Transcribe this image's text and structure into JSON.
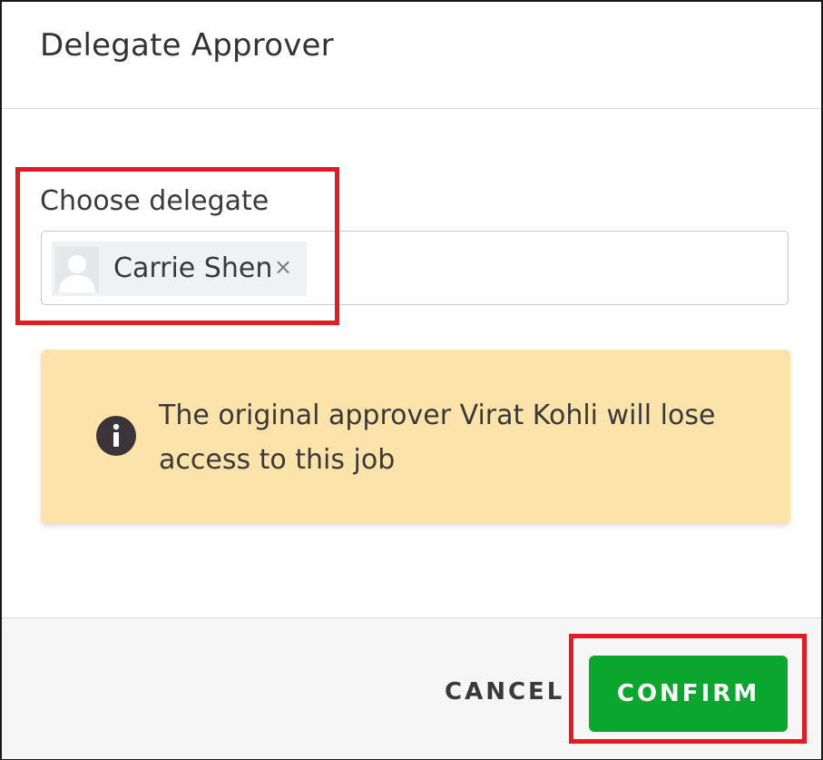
{
  "dialog": {
    "title": "Delegate Approver"
  },
  "delegate_field": {
    "label": "Choose delegate",
    "selected": {
      "name": "Carrie Shen",
      "remove_glyph": "×",
      "avatar_icon": "user-placeholder-icon"
    }
  },
  "notice": {
    "icon": "info-icon",
    "text": "The original approver Virat Kohli will lose access to this job"
  },
  "footer": {
    "cancel_label": "CANCEL",
    "confirm_label": "CONFIRM"
  },
  "colors": {
    "confirm_button": "#0ba62d",
    "notice_background": "#fbe3a9",
    "highlight_border": "#e31b23",
    "footer_background": "#f6f6f6"
  }
}
